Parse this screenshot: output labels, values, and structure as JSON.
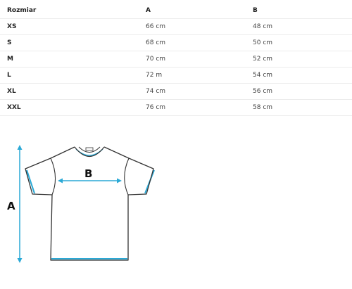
{
  "table": {
    "headers": [
      "Rozmiar",
      "A",
      "B"
    ],
    "rows": [
      [
        "XS",
        "66 cm",
        "48 cm"
      ],
      [
        "S",
        "68 cm",
        "50 cm"
      ],
      [
        "M",
        "70 cm",
        "52 cm"
      ],
      [
        "L",
        "72 m",
        "54 cm"
      ],
      [
        "XL",
        "74 cm",
        "56 cm"
      ],
      [
        "XXL",
        "76 cm",
        "58 cm"
      ]
    ]
  },
  "diagram": {
    "label_length": "A",
    "label_width": "B",
    "accent_color": "#2aa9d6",
    "outline_color": "#333333"
  }
}
